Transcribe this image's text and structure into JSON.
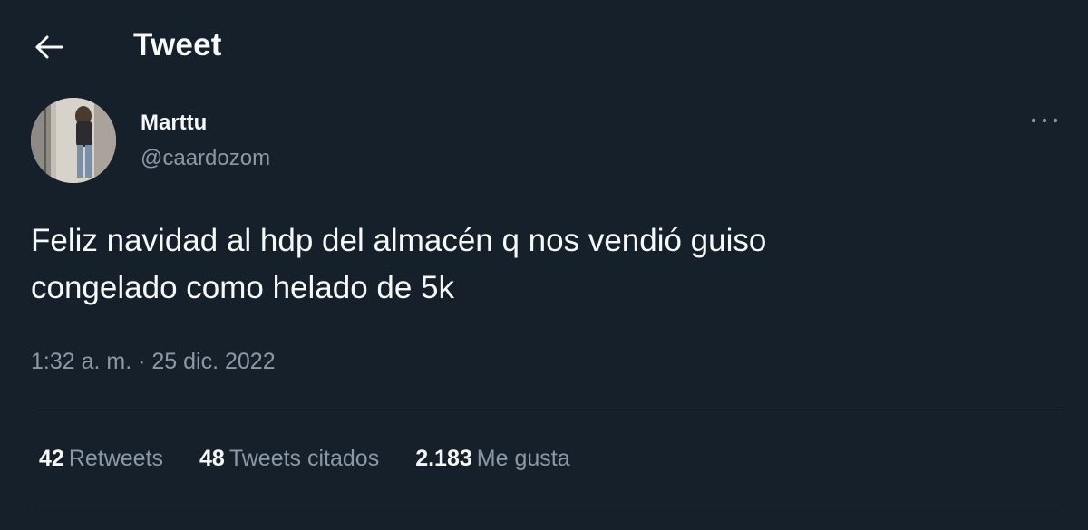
{
  "header": {
    "title": "Tweet",
    "back_icon": "arrow-left-icon"
  },
  "author": {
    "display_name": "Marttu",
    "handle": "@caardozom",
    "more_icon": "more-horizontal-icon"
  },
  "tweet": {
    "text": "Feliz navidad al hdp del almacén q nos vendió guiso\ncongelado como helado de 5k",
    "timestamp": "1:32 a. m. · 25 dic. 2022"
  },
  "stats": [
    {
      "count": "42",
      "label": "Retweets"
    },
    {
      "count": "48",
      "label": "Tweets citados"
    },
    {
      "count": "2.183",
      "label": "Me gusta"
    }
  ],
  "colors": {
    "background": "#15202b",
    "primary_text": "#f7f9f9",
    "secondary_text": "#8b98a5",
    "divider": "#38444d"
  }
}
